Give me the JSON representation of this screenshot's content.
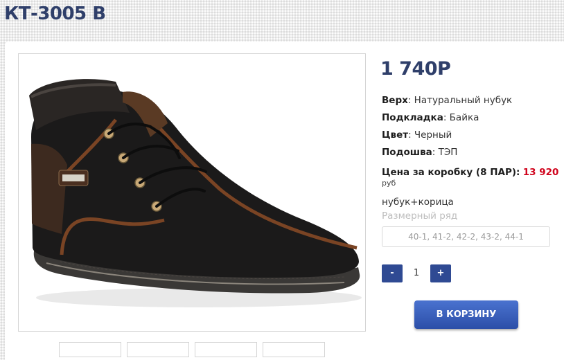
{
  "product": {
    "title": "КТ-3005 В",
    "price": "1 740Р",
    "specs": [
      {
        "label": "Верх",
        "value": "Натуральный нубук"
      },
      {
        "label": "Подкладка",
        "value": "Байка"
      },
      {
        "label": "Цвет",
        "value": "Черный"
      },
      {
        "label": "Подошва",
        "value": "ТЭП"
      }
    ],
    "box_price_label": "Цена за коробку (8 ПАР):",
    "box_price_value": "13 920",
    "currency": "руб",
    "material": "нубук+корица",
    "size_label": "Размерный ряд",
    "sizes": "40-1, 41-2, 42-2, 43-2, 44-1"
  },
  "quantity": {
    "minus": "-",
    "value": "1",
    "plus": "+"
  },
  "cart_button": "В КОРЗИНУ",
  "colors": {
    "title": "#2f3f6a",
    "button": "#2f4a93",
    "highlight_red": "#d0021b"
  }
}
